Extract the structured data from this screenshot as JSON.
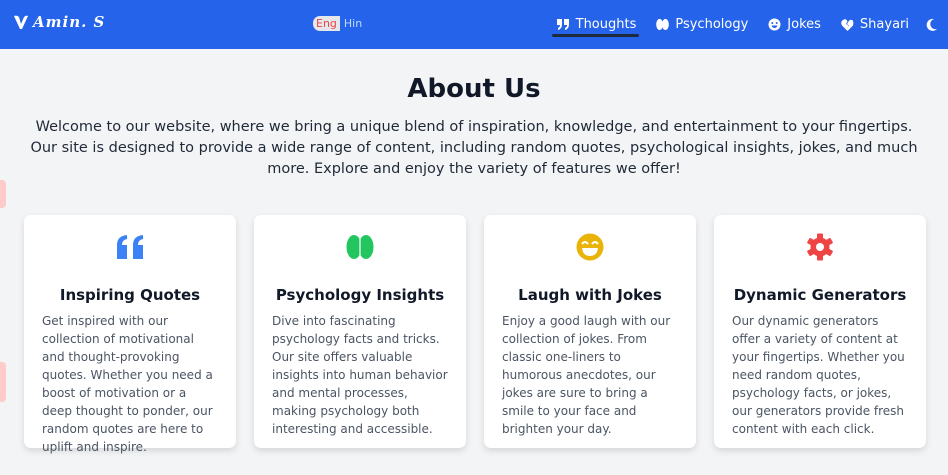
{
  "header": {
    "logo": "Amin. S",
    "lang": {
      "active": "Eng",
      "other": "Hin"
    },
    "nav": [
      {
        "label": "Thoughts",
        "icon": "quote-icon",
        "active": true
      },
      {
        "label": "Psychology",
        "icon": "brain-icon"
      },
      {
        "label": "Jokes",
        "icon": "smile-icon"
      },
      {
        "label": "Shayari",
        "icon": "heart-broken-icon"
      }
    ],
    "theme_icon": "moon-icon"
  },
  "main": {
    "title": "About Us",
    "intro": "Welcome to our website, where we bring a unique blend of inspiration, knowledge, and entertainment to your fingertips. Our site is designed to provide a wide range of content, including random quotes, psychological insights, jokes, and much more. Explore and enjoy the variety of features we offer!",
    "cards": [
      {
        "title": "Inspiring Quotes",
        "icon": "quote-icon",
        "color": "#3b82f6",
        "text": "Get inspired with our collection of motivational and thought-provoking quotes. Whether you need a boost of motivation or a deep thought to ponder, our random quotes are here to uplift and inspire."
      },
      {
        "title": "Psychology Insights",
        "icon": "brain-icon",
        "color": "#22c55e",
        "text": "Dive into fascinating psychology facts and tricks. Our site offers valuable insights into human behavior and mental processes, making psychology both interesting and accessible."
      },
      {
        "title": "Laugh with Jokes",
        "icon": "laugh-icon",
        "color": "#eab308",
        "text": "Enjoy a good laugh with our collection of jokes. From classic one-liners to humorous anecdotes, our jokes are sure to bring a smile to your face and brighten your day."
      },
      {
        "title": "Dynamic Generators",
        "icon": "gear-icon",
        "color": "#ef4444",
        "text": "Our dynamic generators offer a variety of content at your fingertips. Whether you need random quotes, psychology facts, or jokes, our generators provide fresh content with each click."
      }
    ]
  }
}
